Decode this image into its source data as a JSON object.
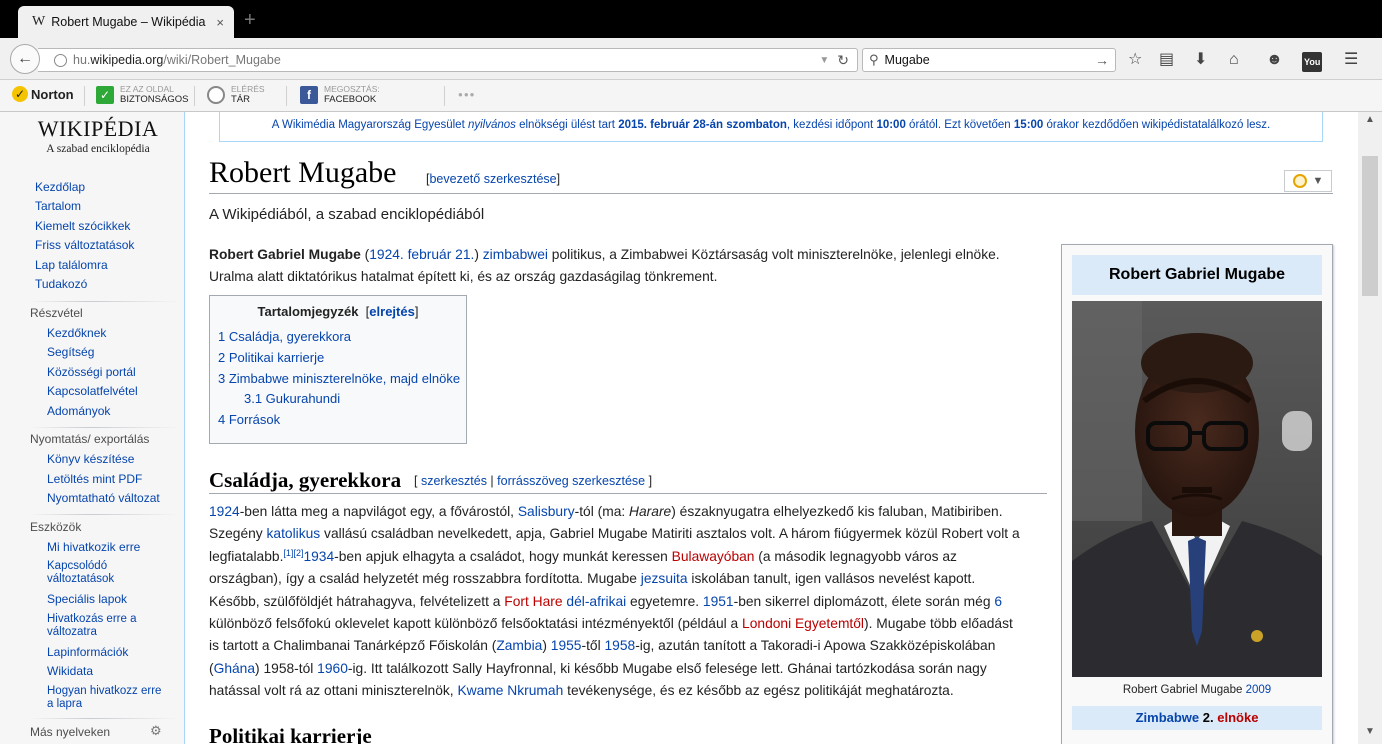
{
  "browser": {
    "tab_title": "Robert Mugabe – Wikipédia",
    "tab_favicon": "W",
    "tab_close": "×",
    "new_tab": "+",
    "url_prefix": "hu.",
    "url_domain": "wikipedia.org",
    "url_path": "/wiki/Robert_Mugabe",
    "search_value": "Mugabe",
    "icons": [
      "back-icon",
      "globe-icon",
      "reload-icon",
      "search-icon",
      "star-icon",
      "clipboard-icon",
      "download-icon",
      "home-icon",
      "chat-icon",
      "youtube-icon",
      "menu-icon"
    ]
  },
  "norton": {
    "logo": "Norton",
    "safe_small": "EZ AZ OLDAL",
    "safe_big": "BIZTONSÁGOS",
    "vault_small": "ELÉRÉS",
    "vault_big": "TÁR",
    "share_small": "MEGOSZTÁS:",
    "share_big": "FACEBOOK",
    "more": "●●●"
  },
  "sidebar": {
    "logo_title": "WIKIPÉDIA",
    "logo_sub": "A szabad enciklopédia",
    "main": [
      "Kezdőlap",
      "Tartalom",
      "Kiemelt szócikkek",
      "Friss változtatások",
      "Lap találomra",
      "Tudakozó"
    ],
    "participation_head": "Részvétel",
    "participation": [
      "Kezdőknek",
      "Segítség",
      "Közösségi portál",
      "Kapcsolatfelvétel",
      "Adományok"
    ],
    "print_head": "Nyomtatás/ exportálás",
    "print": [
      "Könyv készítése",
      "Letöltés mint PDF",
      "Nyomtatható változat"
    ],
    "tools_head": "Eszközök",
    "tools": [
      "Mi hivatkozik erre",
      "Kapcsolódó",
      "változtatások",
      "Speciális lapok",
      "Hivatkozás erre a",
      "változatra",
      "Lapinformációk",
      "Wikidata",
      "Hogyan hivatkozz erre",
      "a lapra"
    ],
    "languages_head": "Más nyelveken"
  },
  "banner": {
    "t1": "A Wikimédia Magyarország Egyesület ",
    "t2": "nyilvános",
    "t3": " elnökségi ülést tart ",
    "t4": "2015. február 28-án szombaton",
    "t5": ", kezdési időpont ",
    "t6": "10:00",
    "t7": " órától. Ezt követően ",
    "t8": "15:00",
    "t9": " órakor kezdődően wikipédistatalálkozó lesz."
  },
  "article": {
    "title": "Robert Mugabe",
    "title_edit_open": "[",
    "title_edit": "bevezető szerkesztése",
    "title_edit_close": "]",
    "tagline": "A Wikipédiából, a szabad enciklopédiából",
    "intro": {
      "name": "Robert Gabriel Mugabe",
      "open": " (",
      "date": "1924. február 21.",
      "close": ") ",
      "nation": "zimbabwei",
      "rest": " politikus, a Zimbabwei Köztársaság volt miniszterelnöke, jelenlegi elnöke.",
      "line2": "Uralma alatt diktatórikus hatalmat épített ki, és az ország gazdaságilag tönkrement."
    },
    "toc": {
      "title": "Tartalomjegyzék",
      "hide_open": "[",
      "hide": "elrejtés",
      "hide_close": "]",
      "items": [
        "1 Családja, gyerekkora",
        "2 Politikai karrierje",
        "3 Zimbabwe miniszterelnöke, majd elnöke",
        "3.1 Gukurahundi",
        "4 Források"
      ]
    },
    "section1": {
      "title": "Családja, gyerekkora",
      "edit_open": "[ ",
      "edit": "szerkesztés",
      "sep": " | ",
      "source_edit": "forrásszöveg szerkesztése",
      "edit_close": " ]"
    },
    "section2_title": "Politikai karrierje",
    "body": {
      "l1a": "1924",
      "l1b": "-ben látta meg a napvilágot egy, a fővárostól, ",
      "l1c": "Salisbury",
      "l1d": "-tól (ma: ",
      "l1e": "Harare",
      "l1f": ") északnyugatra elhelyezkedő kis faluban, Matibiriben.",
      "l2a": "Szegény ",
      "l2b": "katolikus",
      "l2c": " vallású családban nevelkedett, apja, Gabriel Mugabe Matiriti asztalos volt. A három fiúgyermek közül Robert volt a",
      "l3a": "legfiatalabb.",
      "l3b": "[1]",
      "l3c": "[2]",
      "l3d": "1934",
      "l3e": "-ben apjuk elhagyta a családot, hogy munkát keressen ",
      "l3f": "Bulawayóban",
      "l3g": " (a második legnagyobb város az",
      "l4a": "országban), így a család helyzetét még rosszabbra fordította. Mugabe ",
      "l4b": "jezsuita",
      "l4c": " iskolában tanult, igen vallásos nevelést kapott.",
      "l5a": "Később, szülőföldjét hátrahagyva, felvételizett a ",
      "l5b": "Fort Hare",
      "l5c": " ",
      "l5d": "dél-afrikai",
      "l5e": " egyetemre. ",
      "l5f": "1951",
      "l5g": "-ben sikerrel diplomázott, élete során még ",
      "l5h": "6",
      "l6a": "különböző felsőfokú oklevelet kapott különböző felsőoktatási intézményektől (például a ",
      "l6b": "Londoni Egyetemtől",
      "l6c": "). Mugabe több előadást",
      "l7a": "is tartott a Chalimbanai Tanárképző Főiskolán (",
      "l7b": "Zambia",
      "l7c": ") ",
      "l7d": "1955",
      "l7e": "-től ",
      "l7f": "1958",
      "l7g": "-ig, azután tanított a Takoradi-i Apowa Szakközépiskolában",
      "l8a": "(",
      "l8b": "Ghána",
      "l8c": ") 1958-tól ",
      "l8d": "1960",
      "l8e": "-ig. Itt találkozott Sally Hayfronnal, ki később Mugabe első felesége lett. Ghánai tartózkodása során nagy",
      "l9a": "hatással volt rá az ottani miniszterelnök, ",
      "l9b": "Kwame Nkrumah",
      "l9c": " tevékenysége, és ez később az egész politikáját meghatározta."
    }
  },
  "infobox": {
    "title": "Robert Gabriel Mugabe",
    "caption_text": "Robert Gabriel Mugabe ",
    "caption_year": "2009",
    "row_a": "Zimbabwe",
    "row_b": " 2. ",
    "row_c": "elnöke"
  }
}
